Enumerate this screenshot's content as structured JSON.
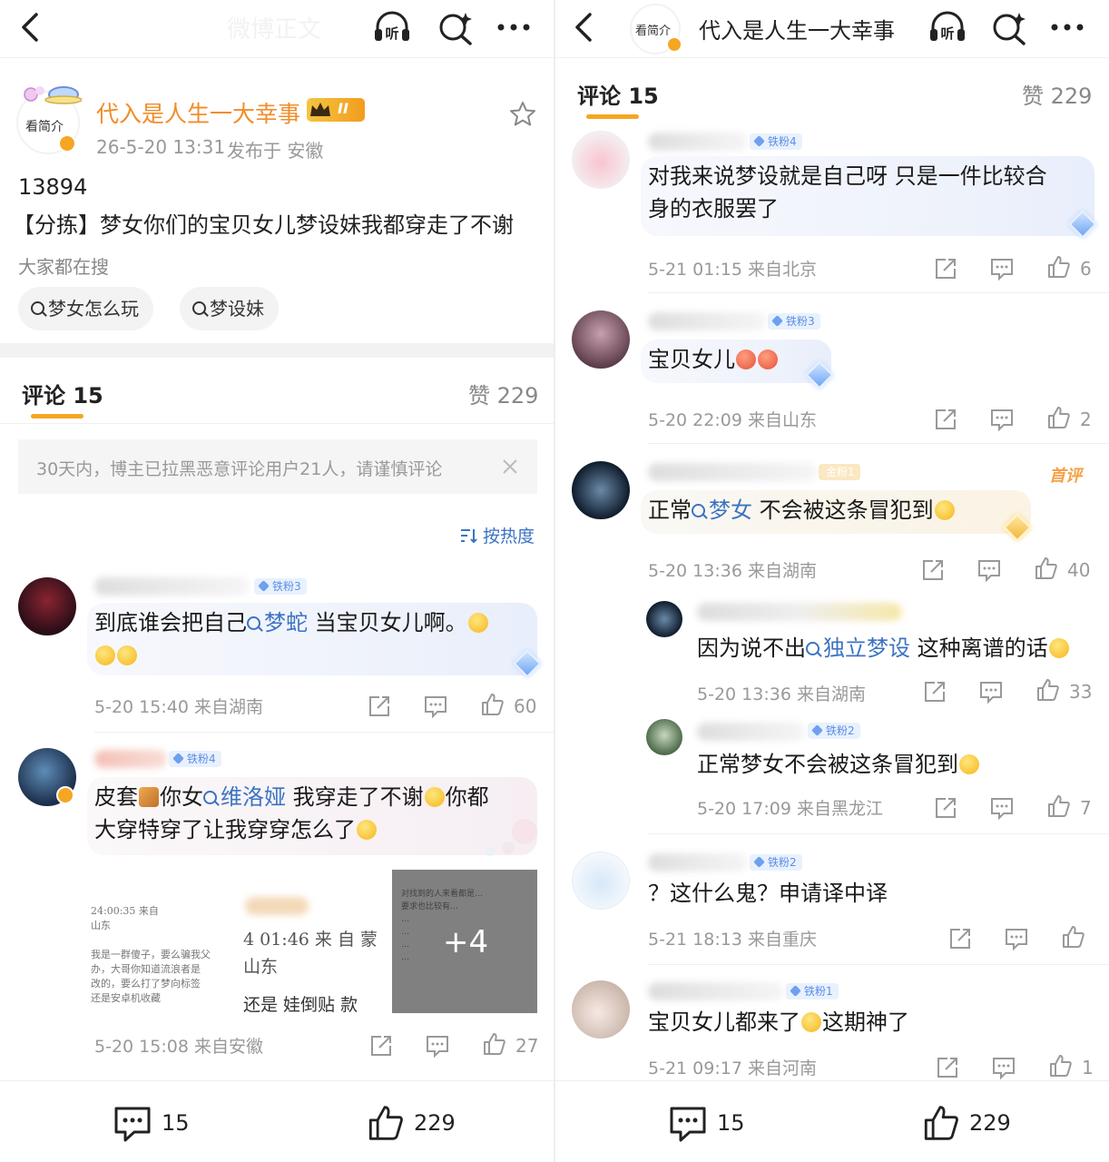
{
  "left": {
    "nav": {
      "faded_title": "微博正文"
    },
    "post": {
      "avatar_text": "看简介",
      "author": "代入是人生一大幸事",
      "vip_badge": "II",
      "time": "26-5-20 13:31",
      "location": "发布于 安徽",
      "line1": "13894",
      "line2": "【分拣】梦女你们的宝贝女儿梦设妹我都穿走了不谢",
      "search_label": "大家都在搜",
      "chips": [
        "梦女怎么玩",
        "梦设妹"
      ]
    },
    "comments_header": {
      "tab": "评论 15",
      "likes": "赞 229"
    },
    "notice": "30天内，博主已拉黑恶意评论用户21人，请谨慎评论",
    "sort_label": "按热度",
    "comments": [
      {
        "badge": "铁粉3",
        "text_a": "到底谁会把自己",
        "link": "梦蛇",
        "text_b": "当宝贝女儿啊。",
        "meta": "5-20 15:40  来自湖南",
        "likes": "60"
      },
      {
        "badge": "铁粉4",
        "text_a": "皮套",
        "text_b": "你女",
        "link": "维洛娅",
        "text_c": "我穿走了不谢",
        "text_d": "你都",
        "line2": "大穿特穿了让我穿穿怎么了",
        "image_text1": "4 01:46  来 自 蒙",
        "image_text2": "还是 娃倒贴 款",
        "image_text3": "山东",
        "more_count": "+4",
        "meta": "5-20 15:08  来自安徽",
        "likes": "27"
      }
    ],
    "bottom": {
      "comments": "15",
      "likes": "229"
    }
  },
  "right": {
    "nav": {
      "avatar_text": "看简介",
      "title": "代入是人生一大幸事"
    },
    "comments_header": {
      "tab": "评论 15",
      "likes": "赞 229"
    },
    "comments": [
      {
        "badge": "铁粉4",
        "line1": "对我来说梦设就是自己呀 只是一件比较合",
        "line2": "身的衣服罢了",
        "meta": "5-21 01:15  来自北京",
        "likes": "6"
      },
      {
        "badge": "铁粉3",
        "text": "宝贝女儿",
        "meta": "5-20 22:09  来自山东",
        "likes": "2"
      },
      {
        "badge": "金粉1",
        "tag": "首评",
        "text_a": "正常",
        "link": "梦女",
        "text_b": "不会被这条冒犯到",
        "meta": "5-20 13:36  来自湖南",
        "likes": "40"
      },
      {
        "text_a": "因为说不出",
        "link": "独立梦设",
        "text_b": "这种离谱的话",
        "meta": "5-20 13:36  来自湖南",
        "likes": "33"
      },
      {
        "badge": "铁粉2",
        "text": "正常梦女不会被这条冒犯到",
        "meta": "5-20 17:09  来自黑龙江",
        "likes": "7"
      },
      {
        "badge": "铁粉2",
        "text": "？这什么鬼？申请译中译",
        "meta": "5-21 18:13  来自重庆",
        "likes": ""
      },
      {
        "badge": "铁粉1",
        "text_a": "宝贝女儿都来了",
        "text_b": "这期神了",
        "meta": "5-21 09:17  来自河南",
        "likes": "1"
      }
    ],
    "bottom": {
      "comments": "15",
      "likes": "229"
    }
  },
  "colors": {
    "accent": "#f5a623",
    "link": "#3b73c2",
    "author": "#f28c28",
    "meta": "#999999"
  },
  "icons": [
    "back-arrow-icon",
    "listen-icon",
    "search-spark-icon",
    "more-icon",
    "star-icon",
    "share-icon",
    "comment-icon",
    "like-icon",
    "search-icon",
    "close-icon",
    "sort-icon",
    "diamond-icon"
  ]
}
